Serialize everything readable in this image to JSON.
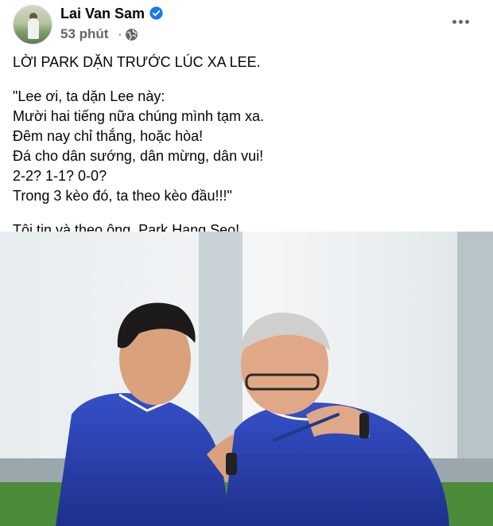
{
  "post": {
    "author": "Lai Van Sam",
    "time": "53 phút",
    "separator": "·",
    "privacy_icon": "globe-icon",
    "verified_icon": "verified-badge-icon",
    "more_icon": "more-options-icon",
    "text": {
      "headline": "LỜI PARK DẶN TRƯỚC LÚC XA LEE.",
      "quote_lines": [
        "\"Lee ơi, ta dặn Lee này:",
        "Mười hai tiếng nữa chúng mình tạm xa.",
        "Đêm nay chỉ thắng, hoặc hòa!",
        "Đá cho dân sướng, dân mừng, dân vui!",
        "2-2? 1-1? 0-0?",
        "Trong 3 kèo đó, ta theo kèo đầu!!!\""
      ],
      "closing": "Tôi tin và theo ông, Park Hang Seo!"
    }
  },
  "colors": {
    "accent_blue": "#1877f2",
    "secondary_text": "#65676b",
    "jersey_blue": "#2b3fb3"
  }
}
